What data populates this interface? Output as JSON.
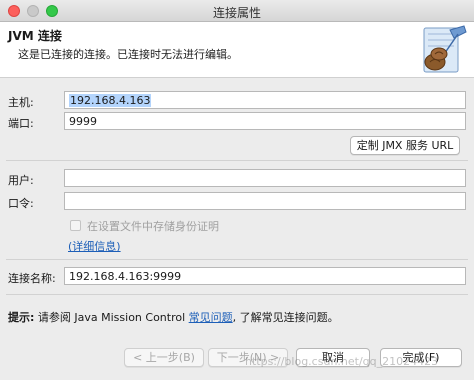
{
  "window": {
    "title": "连接属性"
  },
  "header": {
    "title": "JVM 连接",
    "description": "这是已连接的连接。已连接时无法进行编辑。"
  },
  "form": {
    "host_label": "主机:",
    "host_value": "192.168.4.163",
    "port_label": "端口:",
    "port_value": "9999",
    "jmx_url_button": "定制 JMX 服务 URL",
    "user_label": "用户:",
    "user_value": "",
    "password_label": "口令:",
    "password_value": "",
    "store_credentials_label": "在设置文件中存储身份证明",
    "store_credentials_checked": false,
    "details_link": "(详细信息)",
    "connection_name_label": "连接名称:",
    "connection_name_value": "192.168.4.163:9999"
  },
  "hint": {
    "prefix": "提示:",
    "text_before": " 请参阅 Java Mission Control ",
    "link": "常见问题",
    "text_after": ", 了解常见连接问题。"
  },
  "buttons": {
    "back": "< 上一步(B)",
    "next": "下一步(N) >",
    "cancel": "取消",
    "finish": "完成(F)"
  },
  "watermark": "https://blog.csdn.net/qq_21024423"
}
